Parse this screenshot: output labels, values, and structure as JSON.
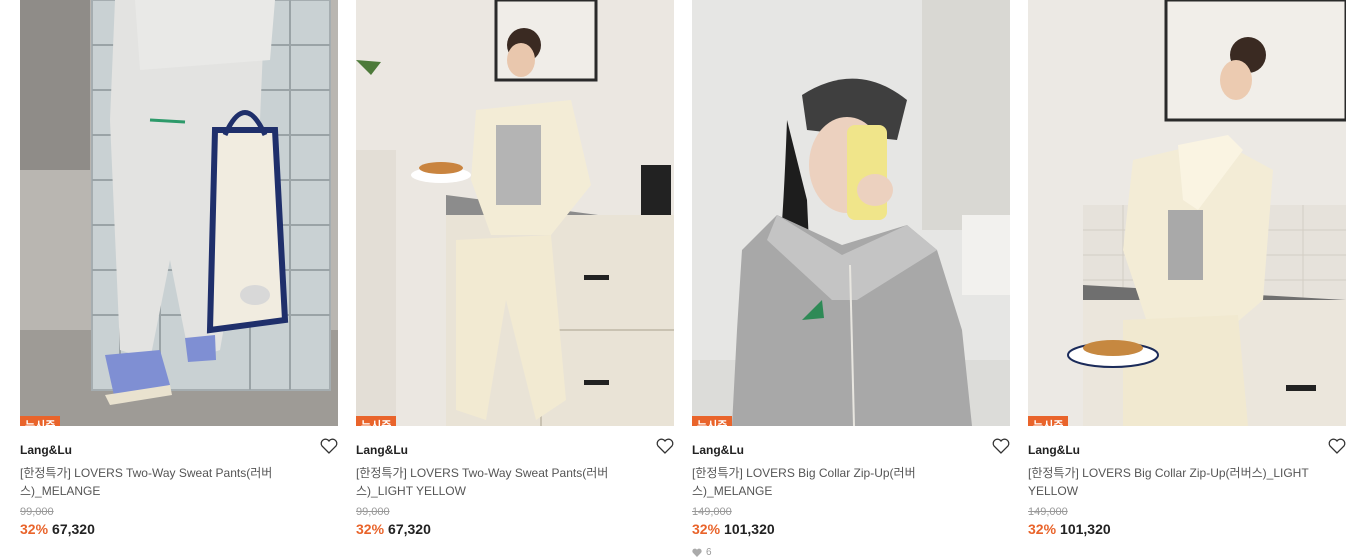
{
  "products": [
    {
      "badge": "뉴시즌",
      "brand": "Lang&Lu",
      "title": "[한정특가] LOVERS Two-Way Sweat Pants(러버스)_MELANGE",
      "original_price": "99,000",
      "discount": "32%",
      "price": "67,320",
      "likes": ""
    },
    {
      "badge": "뉴시즌",
      "brand": "Lang&Lu",
      "title": "[한정특가] LOVERS Two-Way Sweat Pants(러버스)_LIGHT YELLOW",
      "original_price": "99,000",
      "discount": "32%",
      "price": "67,320",
      "likes": ""
    },
    {
      "badge": "뉴시즌",
      "brand": "Lang&Lu",
      "title": "[한정특가] LOVERS Big Collar Zip-Up(러버스)_MELANGE",
      "original_price": "149,000",
      "discount": "32%",
      "price": "101,320",
      "likes": "6"
    },
    {
      "badge": "뉴시즌",
      "brand": "Lang&Lu",
      "title": "[한정특가] LOVERS Big Collar Zip-Up(러버스)_LIGHT YELLOW",
      "original_price": "149,000",
      "discount": "32%",
      "price": "101,320",
      "likes": ""
    }
  ],
  "colors": {
    "accent": "#e9642b",
    "strike": "#999999"
  },
  "icons": {
    "wishlist": "heart-outline-icon",
    "likes": "heart-filled-icon"
  }
}
